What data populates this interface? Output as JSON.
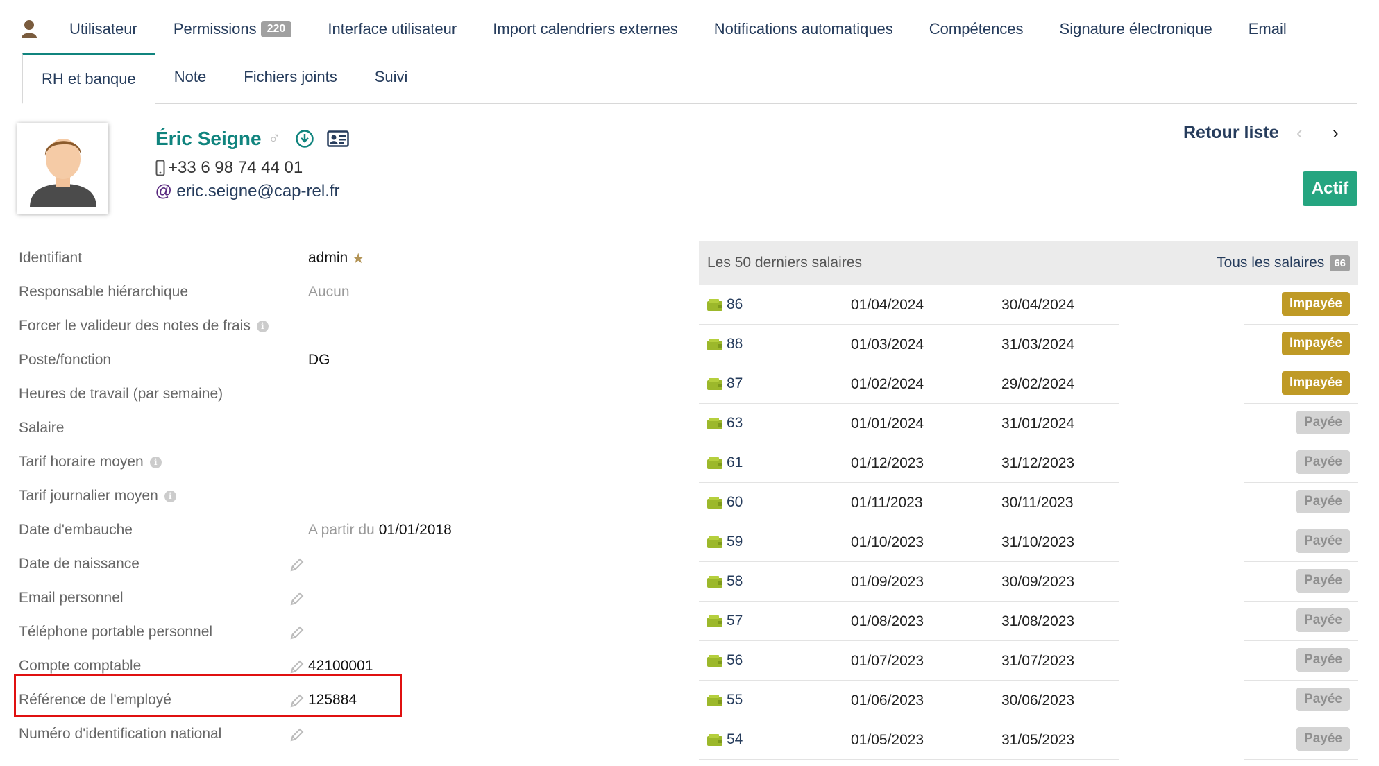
{
  "tabs_main": [
    {
      "label": "Utilisateur"
    },
    {
      "label": "Permissions",
      "badge": "220"
    },
    {
      "label": "Interface utilisateur"
    },
    {
      "label": "Import calendriers externes"
    },
    {
      "label": "Notifications automatiques"
    },
    {
      "label": "Compétences"
    },
    {
      "label": "Signature électronique"
    },
    {
      "label": "Email"
    }
  ],
  "tabs_sub": [
    {
      "label": "RH et banque",
      "active": true
    },
    {
      "label": "Note"
    },
    {
      "label": "Fichiers joints"
    },
    {
      "label": "Suivi"
    }
  ],
  "employee": {
    "name": "Éric Seigne",
    "gender_symbol": "♂",
    "phone": "+33 6 98 74 44 01",
    "email_prefix": "@",
    "email": "eric.seigne@cap-rel.fr"
  },
  "nav": {
    "back_label": "Retour liste",
    "prev_symbol": "‹",
    "next_symbol": "›",
    "status": "Actif"
  },
  "info": {
    "rows": [
      {
        "label": "Identifiant",
        "value": "admin",
        "star": "★"
      },
      {
        "label": "Responsable hiérarchique",
        "value": "Aucun"
      },
      {
        "label": "Forcer le valideur des notes de frais",
        "info": "i"
      },
      {
        "label": "Poste/fonction",
        "value": "DG"
      },
      {
        "label": "Heures de travail (par semaine)"
      },
      {
        "label": "Salaire"
      },
      {
        "label": "Tarif horaire moyen",
        "info": "i"
      },
      {
        "label": "Tarif journalier moyen",
        "info": "i"
      },
      {
        "label": "Date d'embauche",
        "value_prefix": "A partir du",
        "value": "01/01/2018"
      },
      {
        "label": "Date de naissance"
      },
      {
        "label": "Email personnel"
      },
      {
        "label": "Téléphone portable personnel"
      },
      {
        "label": "Compte comptable",
        "value": "42100001"
      },
      {
        "label": "Référence de l'employé",
        "value": "125884"
      },
      {
        "label": "Numéro d'identification national"
      }
    ]
  },
  "salaries": {
    "title": "Les 50 derniers salaires",
    "all_label": "Tous les salaires",
    "all_count": "66",
    "rows": [
      {
        "ref": "86",
        "start": "01/04/2024",
        "end": "30/04/2024",
        "status": "Impayée",
        "paid": false
      },
      {
        "ref": "88",
        "start": "01/03/2024",
        "end": "31/03/2024",
        "status": "Impayée",
        "paid": false
      },
      {
        "ref": "87",
        "start": "01/02/2024",
        "end": "29/02/2024",
        "status": "Impayée",
        "paid": false
      },
      {
        "ref": "63",
        "start": "01/01/2024",
        "end": "31/01/2024",
        "status": "Payée",
        "paid": true
      },
      {
        "ref": "61",
        "start": "01/12/2023",
        "end": "31/12/2023",
        "status": "Payée",
        "paid": true
      },
      {
        "ref": "60",
        "start": "01/11/2023",
        "end": "30/11/2023",
        "status": "Payée",
        "paid": true
      },
      {
        "ref": "59",
        "start": "01/10/2023",
        "end": "31/10/2023",
        "status": "Payée",
        "paid": true
      },
      {
        "ref": "58",
        "start": "01/09/2023",
        "end": "30/09/2023",
        "status": "Payée",
        "paid": true
      },
      {
        "ref": "57",
        "start": "01/08/2023",
        "end": "31/08/2023",
        "status": "Payée",
        "paid": true
      },
      {
        "ref": "56",
        "start": "01/07/2023",
        "end": "31/07/2023",
        "status": "Payée",
        "paid": true
      },
      {
        "ref": "55",
        "start": "01/06/2023",
        "end": "30/06/2023",
        "status": "Payée",
        "paid": true
      },
      {
        "ref": "54",
        "start": "01/05/2023",
        "end": "31/05/2023",
        "status": "Payée",
        "paid": true
      }
    ]
  },
  "colors": {
    "accent": "#10847e",
    "link": "#263c5c",
    "active_badge": "#25a580",
    "unpaid_badge": "#bf9a26",
    "paid_badge": "#d4d4d4",
    "highlight": "#e01010"
  }
}
